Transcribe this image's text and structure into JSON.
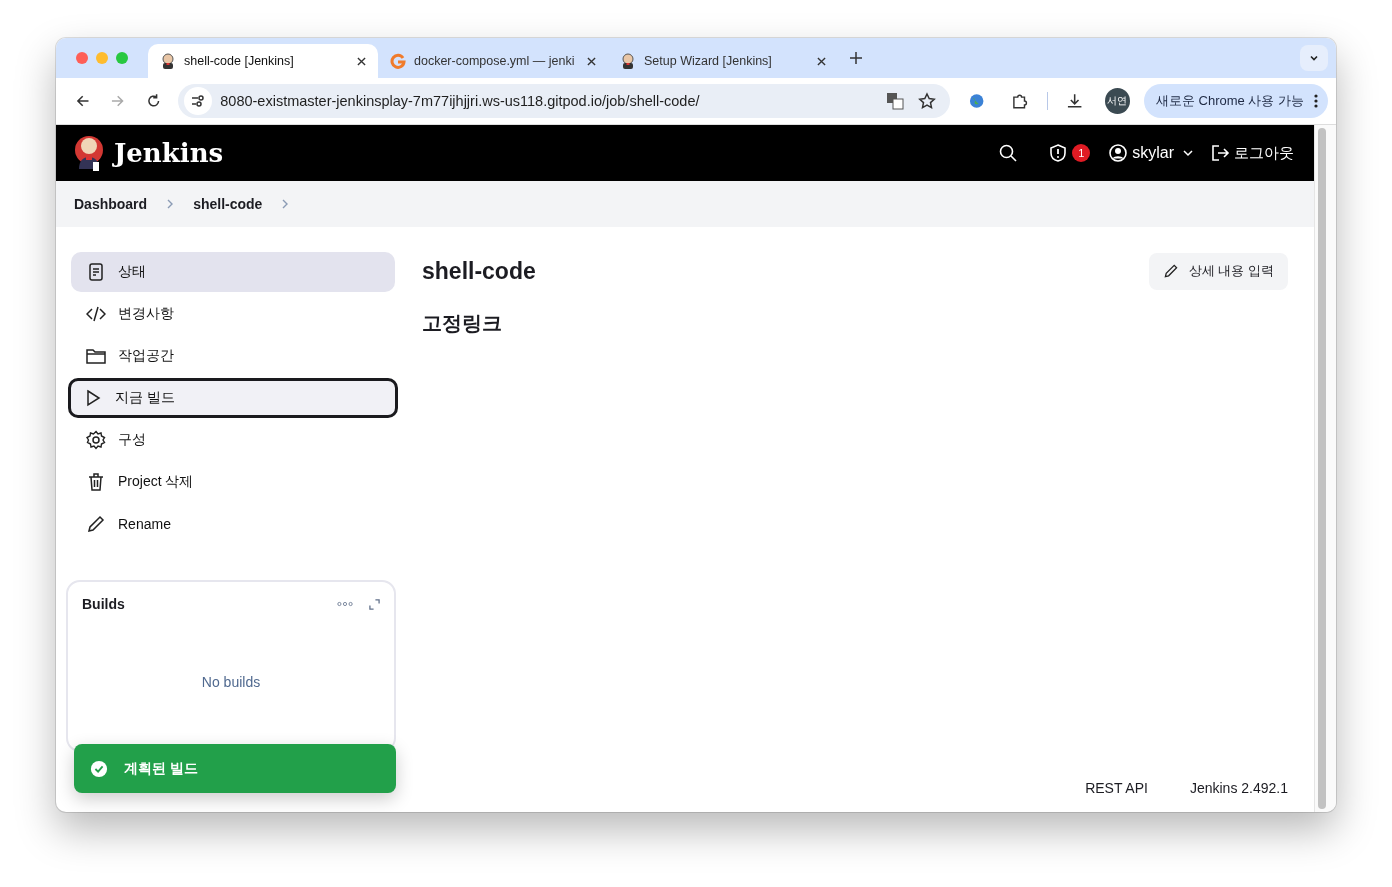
{
  "browser": {
    "tabs": [
      {
        "title": "shell-code [Jenkins]",
        "selected": true
      },
      {
        "title": "docker-compose.yml — jenki",
        "selected": false
      },
      {
        "title": "Setup Wizard [Jenkins]",
        "selected": false
      }
    ],
    "url": "8080-existmaster-jenkinsplay-7m77ijhjjri.ws-us118.gitpod.io/job/shell-code/",
    "profile": "서연",
    "update_button": "새로운 Chrome 사용 가능"
  },
  "header": {
    "logo": "Jenkins",
    "security_count": "1",
    "user": "skylar",
    "logout": "로그아웃"
  },
  "breadcrumbs": [
    "Dashboard",
    "shell-code"
  ],
  "sidebar": {
    "items": [
      {
        "label": "상태",
        "selected": true,
        "focused": false
      },
      {
        "label": "변경사항",
        "selected": false,
        "focused": false
      },
      {
        "label": "작업공간",
        "selected": false,
        "focused": false
      },
      {
        "label": "지금 빌드",
        "selected": false,
        "focused": true
      },
      {
        "label": "구성",
        "selected": false,
        "focused": false
      },
      {
        "label": "Project 삭제",
        "selected": false,
        "focused": false
      },
      {
        "label": "Rename",
        "selected": false,
        "focused": false
      }
    ]
  },
  "builds": {
    "title": "Builds",
    "empty": "No builds"
  },
  "toast": "계획된 빌드",
  "main": {
    "title": "shell-code",
    "edit_button": "상세 내용 입력",
    "permalinks": "고정링크"
  },
  "footer": [
    "REST API",
    "Jenkins 2.492.1"
  ]
}
